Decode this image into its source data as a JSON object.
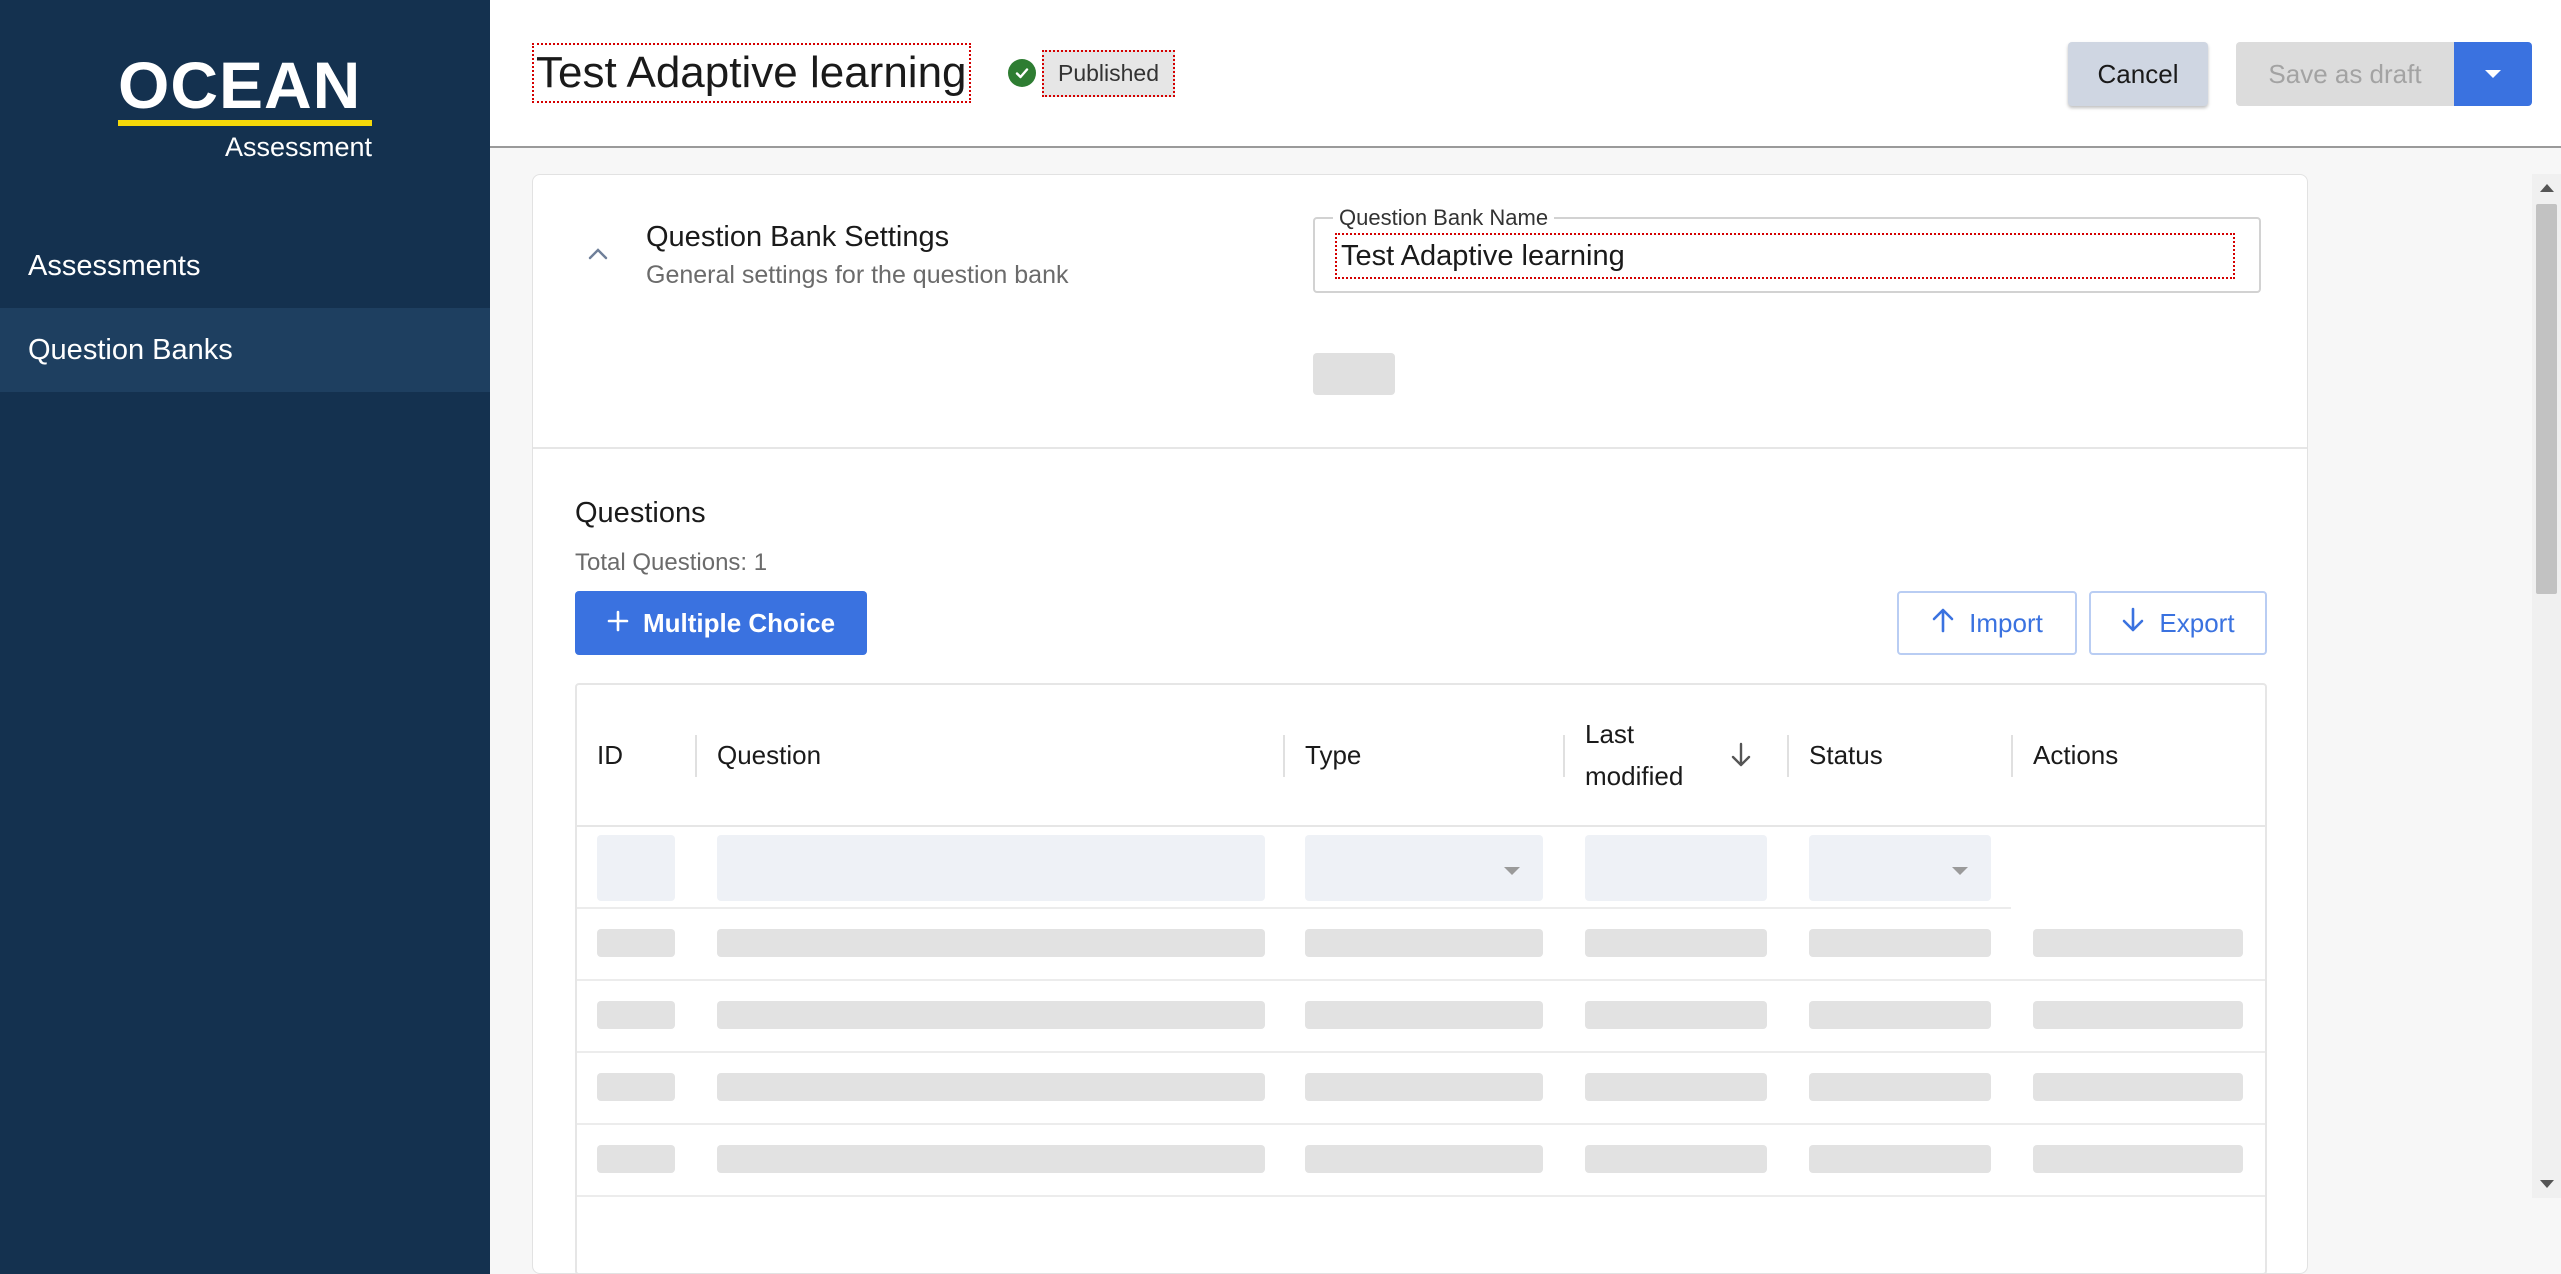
{
  "brand": {
    "name": "OCEAN",
    "subtitle": "Assessment"
  },
  "sidebar": {
    "items": [
      {
        "label": "Assessments",
        "active": false
      },
      {
        "label": "Question Banks",
        "active": true
      }
    ]
  },
  "header": {
    "title": "Test Adaptive learning",
    "status": "Published",
    "cancel_label": "Cancel",
    "save_draft_label": "Save as draft"
  },
  "settings": {
    "title": "Question Bank Settings",
    "subtitle": "General settings for the question bank",
    "name_label": "Question Bank Name",
    "name_value": "Test Adaptive learning"
  },
  "questions": {
    "title": "Questions",
    "total": "Total Questions: 1",
    "add_label": "Multiple Choice",
    "import_label": "Import",
    "export_label": "Export",
    "columns": [
      "ID",
      "Question",
      "Type",
      "Last modified",
      "Status",
      "Actions"
    ]
  },
  "colors": {
    "sidebar_bg": "#14314f",
    "accent": "#3a72e0",
    "logo_bar": "#f5d90a",
    "status_green": "#2e7d32"
  }
}
